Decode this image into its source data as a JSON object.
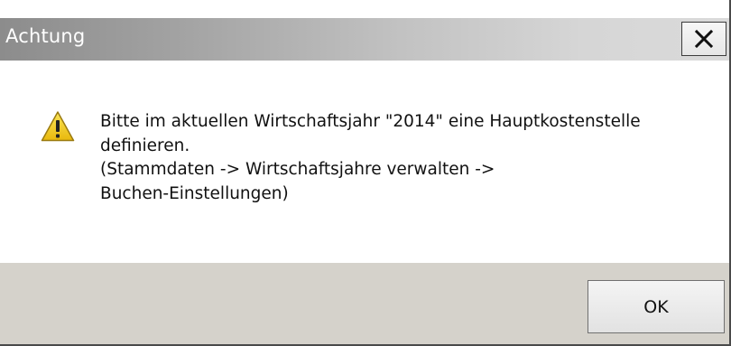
{
  "window": {
    "title": "Achtung",
    "close_icon": "close-icon"
  },
  "message": {
    "icon": "warning-icon",
    "lines": [
      "Bitte im aktuellen Wirtschaftsjahr \"2014\" eine Hauptkostenstelle",
      "definieren.",
      "(Stammdaten -> Wirtschaftsjahre verwalten ->",
      "Buchen-Einstellungen)"
    ]
  },
  "buttons": {
    "ok_label": "OK"
  },
  "colors": {
    "footer_background": "#d5d2cb",
    "warning_yellow": "#f5d320"
  }
}
